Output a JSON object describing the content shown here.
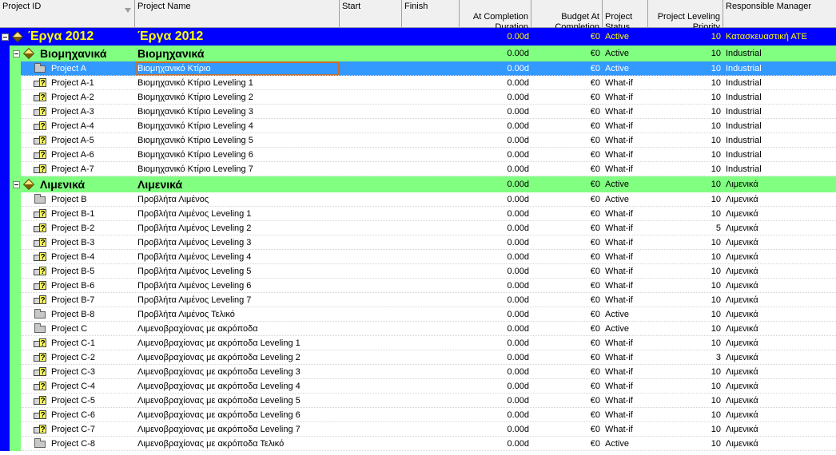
{
  "columns": {
    "project_id": "Project ID",
    "project_name": "Project Name",
    "start": "Start",
    "finish": "Finish",
    "at_completion_duration": "At Completion\nDuration",
    "budget_at_completion": "Budget At\nCompletion",
    "project_status": "Project\nStatus",
    "leveling_priority": "Project Leveling\nPriority",
    "responsible_manager": "Responsible Manager"
  },
  "eps": {
    "id": "Έργα 2012",
    "name": "Έργα 2012",
    "duration": "0.00d",
    "budget": "€0",
    "status": "Active",
    "priority": "10",
    "manager": "Κατασκευαστική ΑΤΕ"
  },
  "groups": [
    {
      "id": "Βιομηχανικά",
      "name": "Βιομηχανικά",
      "duration": "0.00d",
      "budget": "€0",
      "status": "Active",
      "priority": "10",
      "manager": "Industrial",
      "projects": [
        {
          "id": "Project A",
          "name": "Βιομηχανικό Κτίριο",
          "duration": "0.00d",
          "budget": "€0",
          "status": "Active",
          "priority": "10",
          "manager": "Industrial",
          "type": "folder",
          "selected": true
        },
        {
          "id": "Project A-1",
          "name": "Βιομηχανικό Κτίριο Leveling 1",
          "duration": "0.00d",
          "budget": "€0",
          "status": "What-if",
          "priority": "10",
          "manager": "Industrial",
          "type": "whatif"
        },
        {
          "id": "Project A-2",
          "name": "Βιομηχανικό Κτίριο Leveling 2",
          "duration": "0.00d",
          "budget": "€0",
          "status": "What-if",
          "priority": "10",
          "manager": "Industrial",
          "type": "whatif"
        },
        {
          "id": "Project A-3",
          "name": "Βιομηχανικό Κτίριο Leveling 3",
          "duration": "0.00d",
          "budget": "€0",
          "status": "What-if",
          "priority": "10",
          "manager": "Industrial",
          "type": "whatif"
        },
        {
          "id": "Project A-4",
          "name": "Βιομηχανικό Κτίριο Leveling 4",
          "duration": "0.00d",
          "budget": "€0",
          "status": "What-if",
          "priority": "10",
          "manager": "Industrial",
          "type": "whatif"
        },
        {
          "id": "Project A-5",
          "name": "Βιομηχανικό Κτίριο Leveling 5",
          "duration": "0.00d",
          "budget": "€0",
          "status": "What-if",
          "priority": "10",
          "manager": "Industrial",
          "type": "whatif"
        },
        {
          "id": "Project A-6",
          "name": "Βιομηχανικό Κτίριο Leveling 6",
          "duration": "0.00d",
          "budget": "€0",
          "status": "What-if",
          "priority": "10",
          "manager": "Industrial",
          "type": "whatif"
        },
        {
          "id": "Project A-7",
          "name": "Βιομηχανικό Κτίριο Leveling 7",
          "duration": "0.00d",
          "budget": "€0",
          "status": "What-if",
          "priority": "10",
          "manager": "Industrial",
          "type": "whatif"
        }
      ]
    },
    {
      "id": "Λιμενικά",
      "name": "Λιμενικά",
      "duration": "0.00d",
      "budget": "€0",
      "status": "Active",
      "priority": "10",
      "manager": "Λιμενικά",
      "projects": [
        {
          "id": "Project B",
          "name": "Προβλήτα Λιμένος",
          "duration": "0.00d",
          "budget": "€0",
          "status": "Active",
          "priority": "10",
          "manager": "Λιμενικά",
          "type": "folder"
        },
        {
          "id": "Project B-1",
          "name": "Προβλήτα Λιμένος Leveling 1",
          "duration": "0.00d",
          "budget": "€0",
          "status": "What-if",
          "priority": "10",
          "manager": "Λιμενικά",
          "type": "whatif"
        },
        {
          "id": "Project B-2",
          "name": "Προβλήτα Λιμένος Leveling 2",
          "duration": "0.00d",
          "budget": "€0",
          "status": "What-if",
          "priority": "5",
          "manager": "Λιμενικά",
          "type": "whatif"
        },
        {
          "id": "Project B-3",
          "name": "Προβλήτα Λιμένος Leveling 3",
          "duration": "0.00d",
          "budget": "€0",
          "status": "What-if",
          "priority": "10",
          "manager": "Λιμενικά",
          "type": "whatif"
        },
        {
          "id": "Project B-4",
          "name": "Προβλήτα Λιμένος Leveling 4",
          "duration": "0.00d",
          "budget": "€0",
          "status": "What-if",
          "priority": "10",
          "manager": "Λιμενικά",
          "type": "whatif"
        },
        {
          "id": "Project B-5",
          "name": "Προβλήτα Λιμένος Leveling 5",
          "duration": "0.00d",
          "budget": "€0",
          "status": "What-if",
          "priority": "10",
          "manager": "Λιμενικά",
          "type": "whatif"
        },
        {
          "id": "Project B-6",
          "name": "Προβλήτα Λιμένος Leveling 6",
          "duration": "0.00d",
          "budget": "€0",
          "status": "What-if",
          "priority": "10",
          "manager": "Λιμενικά",
          "type": "whatif"
        },
        {
          "id": "Project B-7",
          "name": "Προβλήτα Λιμένος Leveling 7",
          "duration": "0.00d",
          "budget": "€0",
          "status": "What-if",
          "priority": "10",
          "manager": "Λιμενικά",
          "type": "whatif"
        },
        {
          "id": "Project B-8",
          "name": "Προβλήτα Λιμένος Τελικό",
          "duration": "0.00d",
          "budget": "€0",
          "status": "Active",
          "priority": "10",
          "manager": "Λιμενικά",
          "type": "folder"
        },
        {
          "id": "Project C",
          "name": "Λιμενοβραχίονας με ακρόποδα",
          "duration": "0.00d",
          "budget": "€0",
          "status": "Active",
          "priority": "10",
          "manager": "Λιμενικά",
          "type": "folder"
        },
        {
          "id": "Project C-1",
          "name": "Λιμενοβραχίονας με ακρόποδα Leveling 1",
          "duration": "0.00d",
          "budget": "€0",
          "status": "What-if",
          "priority": "10",
          "manager": "Λιμενικά",
          "type": "whatif"
        },
        {
          "id": "Project C-2",
          "name": "Λιμενοβραχίονας με ακρόποδα Leveling 2",
          "duration": "0.00d",
          "budget": "€0",
          "status": "What-if",
          "priority": "3",
          "manager": "Λιμενικά",
          "type": "whatif"
        },
        {
          "id": "Project C-3",
          "name": "Λιμενοβραχίονας με ακρόποδα Leveling 3",
          "duration": "0.00d",
          "budget": "€0",
          "status": "What-if",
          "priority": "10",
          "manager": "Λιμενικά",
          "type": "whatif"
        },
        {
          "id": "Project C-4",
          "name": "Λιμενοβραχίονας με ακρόποδα Leveling 4",
          "duration": "0.00d",
          "budget": "€0",
          "status": "What-if",
          "priority": "10",
          "manager": "Λιμενικά",
          "type": "whatif"
        },
        {
          "id": "Project C-5",
          "name": "Λιμενοβραχίονας με ακρόποδα Leveling 5",
          "duration": "0.00d",
          "budget": "€0",
          "status": "What-if",
          "priority": "10",
          "manager": "Λιμενικά",
          "type": "whatif"
        },
        {
          "id": "Project C-6",
          "name": "Λιμενοβραχίονας με ακρόποδα Leveling 6",
          "duration": "0.00d",
          "budget": "€0",
          "status": "What-if",
          "priority": "10",
          "manager": "Λιμενικά",
          "type": "whatif"
        },
        {
          "id": "Project C-7",
          "name": "Λιμενοβραχίονας με ακρόποδα Leveling 7",
          "duration": "0.00d",
          "budget": "€0",
          "status": "What-if",
          "priority": "10",
          "manager": "Λιμενικά",
          "type": "whatif"
        },
        {
          "id": "Project C-8",
          "name": "Λιμενοβραχίονας με ακρόποδα Τελικό",
          "duration": "0.00d",
          "budget": "€0",
          "status": "Active",
          "priority": "10",
          "manager": "Λιμενικά",
          "type": "folder"
        }
      ]
    }
  ]
}
